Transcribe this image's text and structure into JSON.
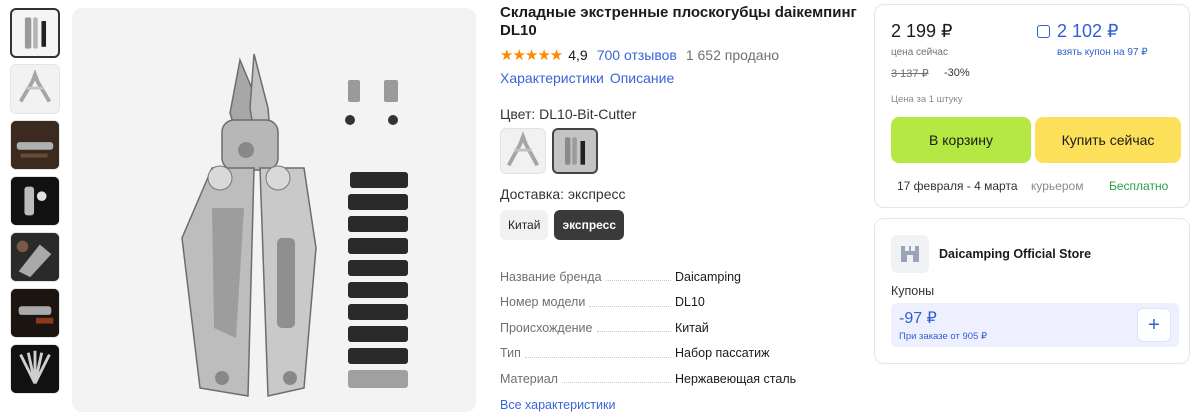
{
  "product": {
    "title": "Складные экстренные плоскогубцы daiкемпинг DL10",
    "stars": "★★★★★",
    "rating": "4,9",
    "reviews": "700 отзывов",
    "sold": "1 652 продано",
    "tabs": [
      "Характеристики",
      "Описание"
    ],
    "color_label": "Цвет: DL10-Bit-Cutter",
    "delivery_label": "Доставка: экспресс",
    "delivery_options": [
      "Китай",
      "экспресс"
    ],
    "specs": [
      {
        "key": "Название бренда",
        "value": "Daicamping"
      },
      {
        "key": "Номер модели",
        "value": "DL10"
      },
      {
        "key": "Происхождение",
        "value": "Китай"
      },
      {
        "key": "Тип",
        "value": "Набор пассатиж"
      },
      {
        "key": "Материал",
        "value": "Нержавеющая сталь"
      }
    ],
    "all_specs_link": "Все характеристики"
  },
  "gallery": {
    "thumbnails": [
      "tool-with-bits",
      "tool-open",
      "tool-in-use",
      "tool-closeup",
      "tool-in-hand",
      "tool-cutting",
      "tool-fanned"
    ],
    "selected_index": 0
  },
  "price_card": {
    "price_now": "2 199 ₽",
    "price_now_label": "цена сейчас",
    "coupon_price": "2 102 ₽",
    "coupon_label": "взять купон на 97 ₽",
    "old_price": "3 137 ₽",
    "discount": "-30%",
    "unit_note": "Цена за 1 штуку",
    "cart_button": "В корзину",
    "buy_button": "Купить сейчас",
    "delivery_date": "17 февраля - 4 марта",
    "delivery_method": "курьером",
    "delivery_cost": "Бесплатно",
    "colors": {
      "cart": "#b6e844",
      "buy": "#fde05a",
      "accent": "#2f5fd0",
      "free": "#2ba04a"
    }
  },
  "store": {
    "name": "Daicamping Official Store",
    "coupons_label": "Купоны",
    "coupon_amount": "-97 ₽",
    "coupon_condition": "При заказе от 905 ₽"
  }
}
